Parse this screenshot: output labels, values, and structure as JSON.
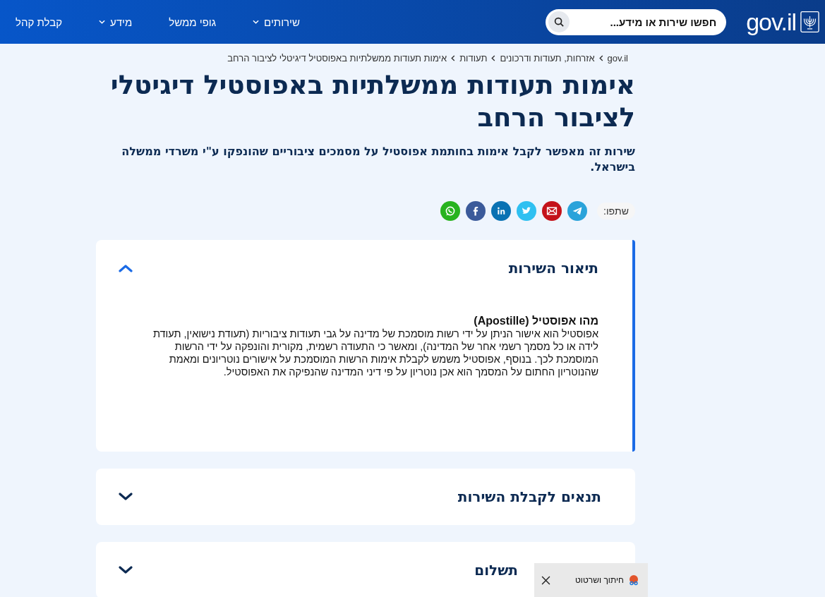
{
  "header": {
    "logo": "gov.il",
    "search": {
      "placeholder": "חפשו שירות או מידע..."
    },
    "nav": [
      {
        "label": "שירותים",
        "has_menu": true
      },
      {
        "label": "גופי ממשל",
        "has_menu": false
      },
      {
        "label": "מידע",
        "has_menu": true
      },
      {
        "label": "קבלת קהל",
        "has_menu": false
      }
    ]
  },
  "breadcrumb": [
    "gov.il",
    "אזרחות, תעודות ודרכונים",
    "תעודות",
    "אימות תעודות ממשלתיות באפוסטיל דיגיטלי לציבור הרחב"
  ],
  "title": "אימות תעודות ממשלתיות באפוסטיל דיגיטלי לציבור הרחב",
  "subtitle": "שירות זה מאפשר לקבל אימות בחותמת אפוסטיל על מסמכים ציבוריים שהונפקו ע\"י משרדי ממשלה בישראל.",
  "share": {
    "label": "שתפו:",
    "channels": [
      {
        "kind": "telegram"
      },
      {
        "kind": "email"
      },
      {
        "kind": "twitter"
      },
      {
        "kind": "linkedin"
      },
      {
        "kind": "facebook"
      },
      {
        "kind": "whatsapp"
      }
    ]
  },
  "sections": [
    {
      "title": "תיאור השירות",
      "expanded": true,
      "content": {
        "heading": "מהו אפוסטיל (Apostille)",
        "paragraphs": [
          "אפוסטיל הוא אישור הניתן על ידי רשות מוסמכת של מדינה על גבי תעודות ציבוריות (תעודת נישואין, תעודת לידה או כל מסמך רשמי אחר של המדינה), ומאשר כי התעודה רשמית, מקורית והונפקה על ידי הרשות המוסמכת לכך. בנוסף, אפוסטיל משמש לקבלת אימות הרשות המוסמכת על אישורים נוטריונים ומאמת",
          "שהנוטריון החתום על המסמך הוא אכן נוטריון על פי דיני המדינה שהנפיקה את האפוסטיל."
        ]
      }
    },
    {
      "title": "תנאים לקבלת השירות",
      "expanded": false
    },
    {
      "title": "תשלום",
      "expanded": false,
      "under_toast": true
    }
  ],
  "toast": {
    "label": "חיתוך ושרטוט"
  }
}
